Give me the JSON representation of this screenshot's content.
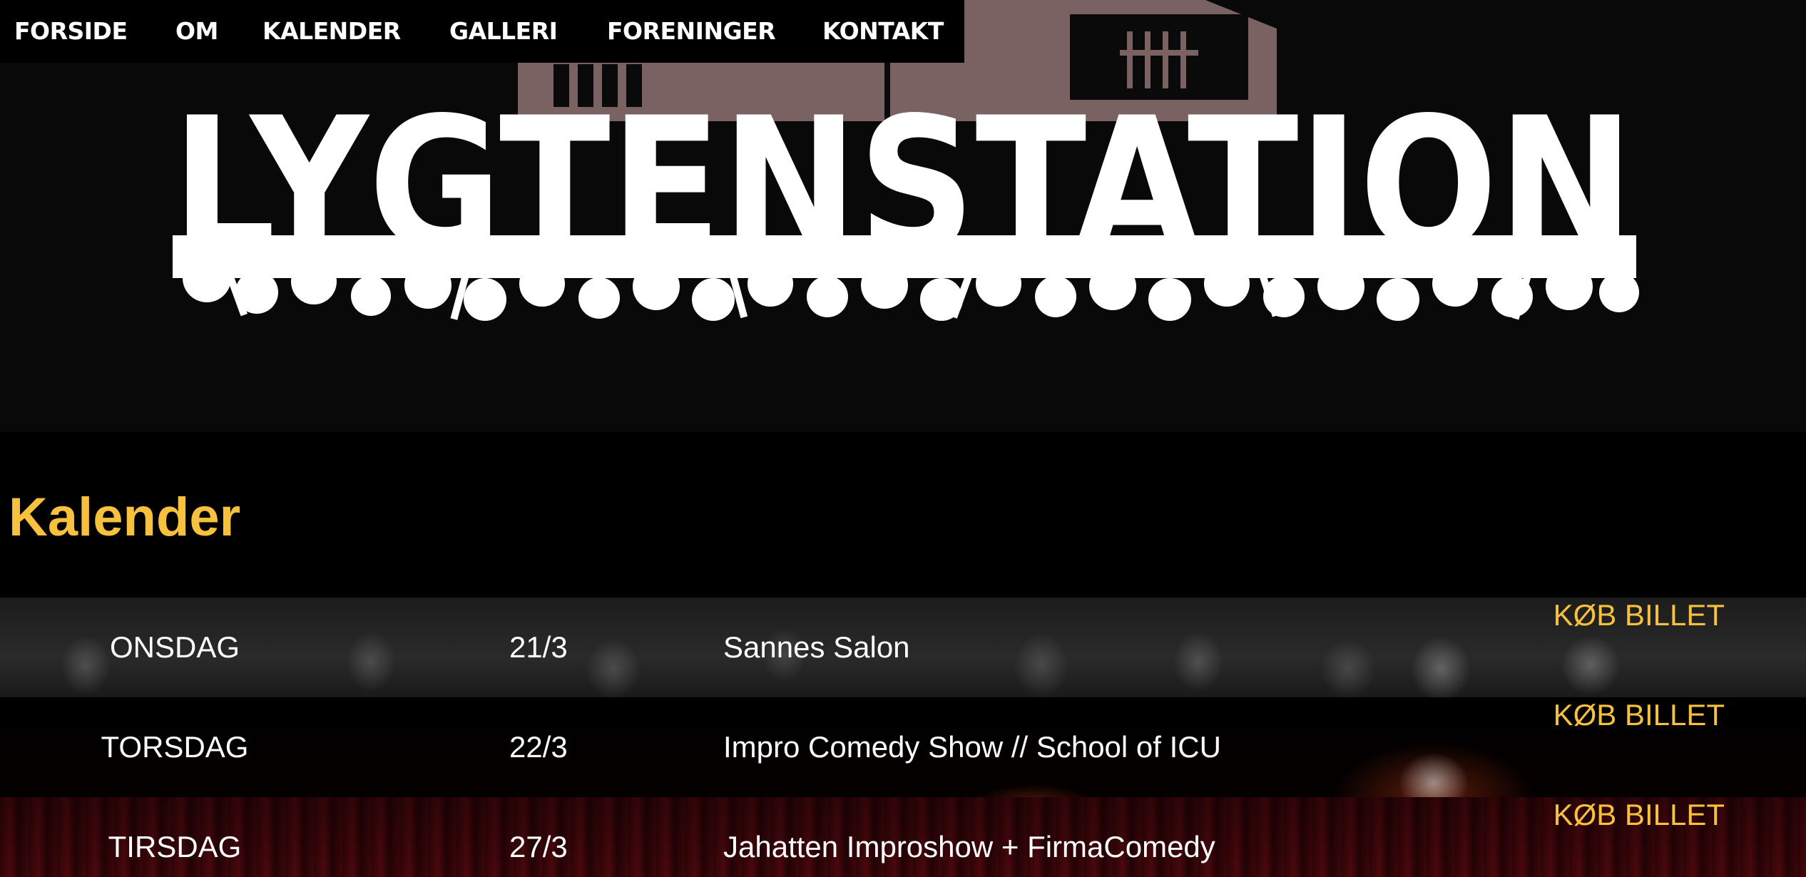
{
  "nav": {
    "items": [
      {
        "label": "FORSIDE"
      },
      {
        "label": "OM"
      },
      {
        "label": "KALENDER"
      },
      {
        "label": "GALLERI"
      },
      {
        "label": "FORENINGER"
      },
      {
        "label": "KONTAKT"
      }
    ]
  },
  "logo": {
    "text": "LYGTENSTATION"
  },
  "calendar": {
    "title": "Kalender",
    "events": [
      {
        "day": "ONSDAG",
        "date": "21/3",
        "title": "Sannes Salon",
        "buy_label": "KØB BILLET"
      },
      {
        "day": "TORSDAG",
        "date": "22/3",
        "title": "Impro Comedy Show // School of ICU",
        "buy_label": "KØB BILLET"
      },
      {
        "day": "TIRSDAG",
        "date": "27/3",
        "title": "Jahatten Improshow + FirmaComedy",
        "buy_label": "KØB BILLET"
      }
    ]
  },
  "colors": {
    "accent": "#f8c13d",
    "background": "#000000",
    "header_background": "#090909",
    "house": "#7a6262"
  }
}
